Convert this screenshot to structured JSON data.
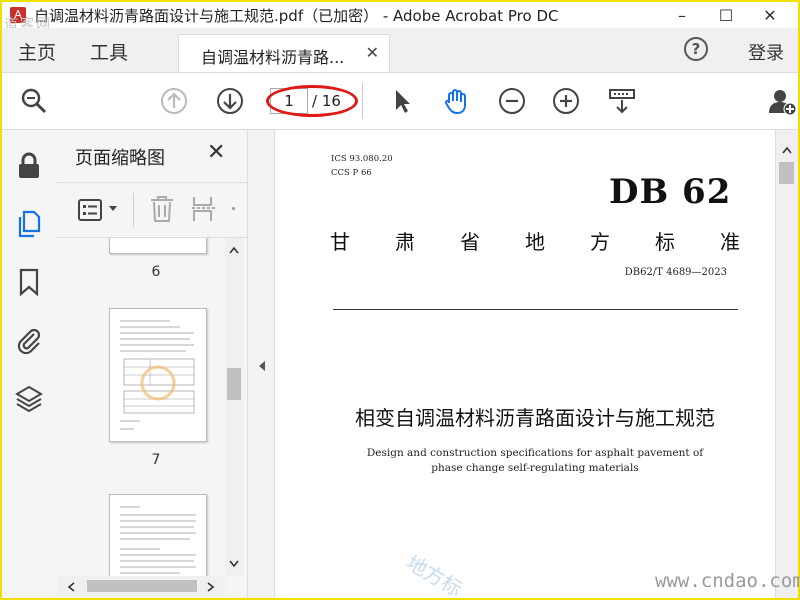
{
  "window": {
    "title": "自调温材料沥青路面设计与施工规范.pdf（已加密） - Adobe Acrobat Pro DC",
    "minimize": "–",
    "maximize": "☐",
    "close": "✕",
    "watermark_top_left": "道客网"
  },
  "tabs": {
    "home": "主页",
    "tools": "工具",
    "document": "自调温材料沥青路...",
    "close": "✕",
    "help": "?",
    "login": "登录"
  },
  "toolbar": {
    "current_page": "1",
    "total_pages": "/ 16"
  },
  "thumbnail_panel": {
    "title": "页面缩略图",
    "close": "✕",
    "pages": [
      {
        "label": "6"
      },
      {
        "label": "7"
      }
    ]
  },
  "document": {
    "ics": "ICS  93.080.20",
    "ccs": "CCS  P  66",
    "db": "DB 62",
    "province_chars": [
      "甘",
      "肃",
      "省",
      "地",
      "方",
      "标",
      "准"
    ],
    "standard_number": "DB62/T 4689—2023",
    "title_cn": "相变自调温材料沥青路面设计与施工规范",
    "title_en_line1": "Design and construction specifications for asphalt pavement of",
    "title_en_line2": "phase change self-regulating materials"
  },
  "watermarks": {
    "diagonal": "地方标",
    "site": "www.cndao.com"
  },
  "colors": {
    "highlight_ellipse": "#e01818",
    "acrobat_blue": "#1473e6",
    "frame": "#f0e000"
  }
}
